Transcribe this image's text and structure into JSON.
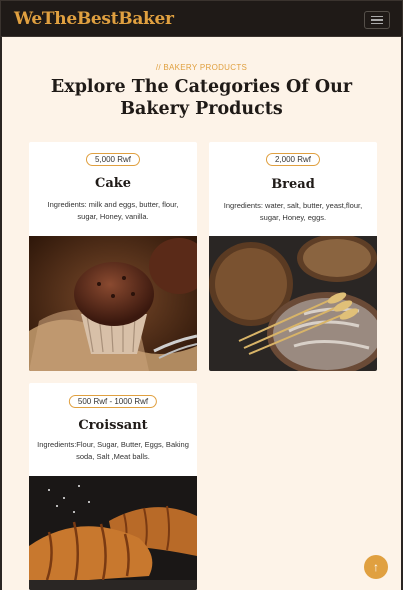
{
  "brand": "WeTheBestBaker",
  "section": {
    "eyebrow": "// BAKERY PRODUCTS",
    "heading": "Explore The Categories Of Our Bakery Products"
  },
  "products": [
    {
      "price": "5,000 Rwf",
      "name": "Cake",
      "ingredients": "Ingredients: milk and eggs, butter, flour, sugar, Honey, vanilla."
    },
    {
      "price": "2,000 Rwf",
      "name": "Bread",
      "ingredients": "Ingredients: water, salt, butter, yeast,flour, sugar, Honey, eggs."
    },
    {
      "price": "500 Rwf - 1000 Rwf",
      "name": "Croissant",
      "ingredients": "Ingredients:Flour, Sugar, Butter, Eggs, Baking soda, Salt ,Meat balls."
    }
  ],
  "icons": {
    "menu": "hamburger-icon",
    "back_to_top": "arrow-up-icon"
  },
  "colors": {
    "accent": "#e0a040",
    "dark": "#1f1a17",
    "background": "#fdf3e8"
  }
}
